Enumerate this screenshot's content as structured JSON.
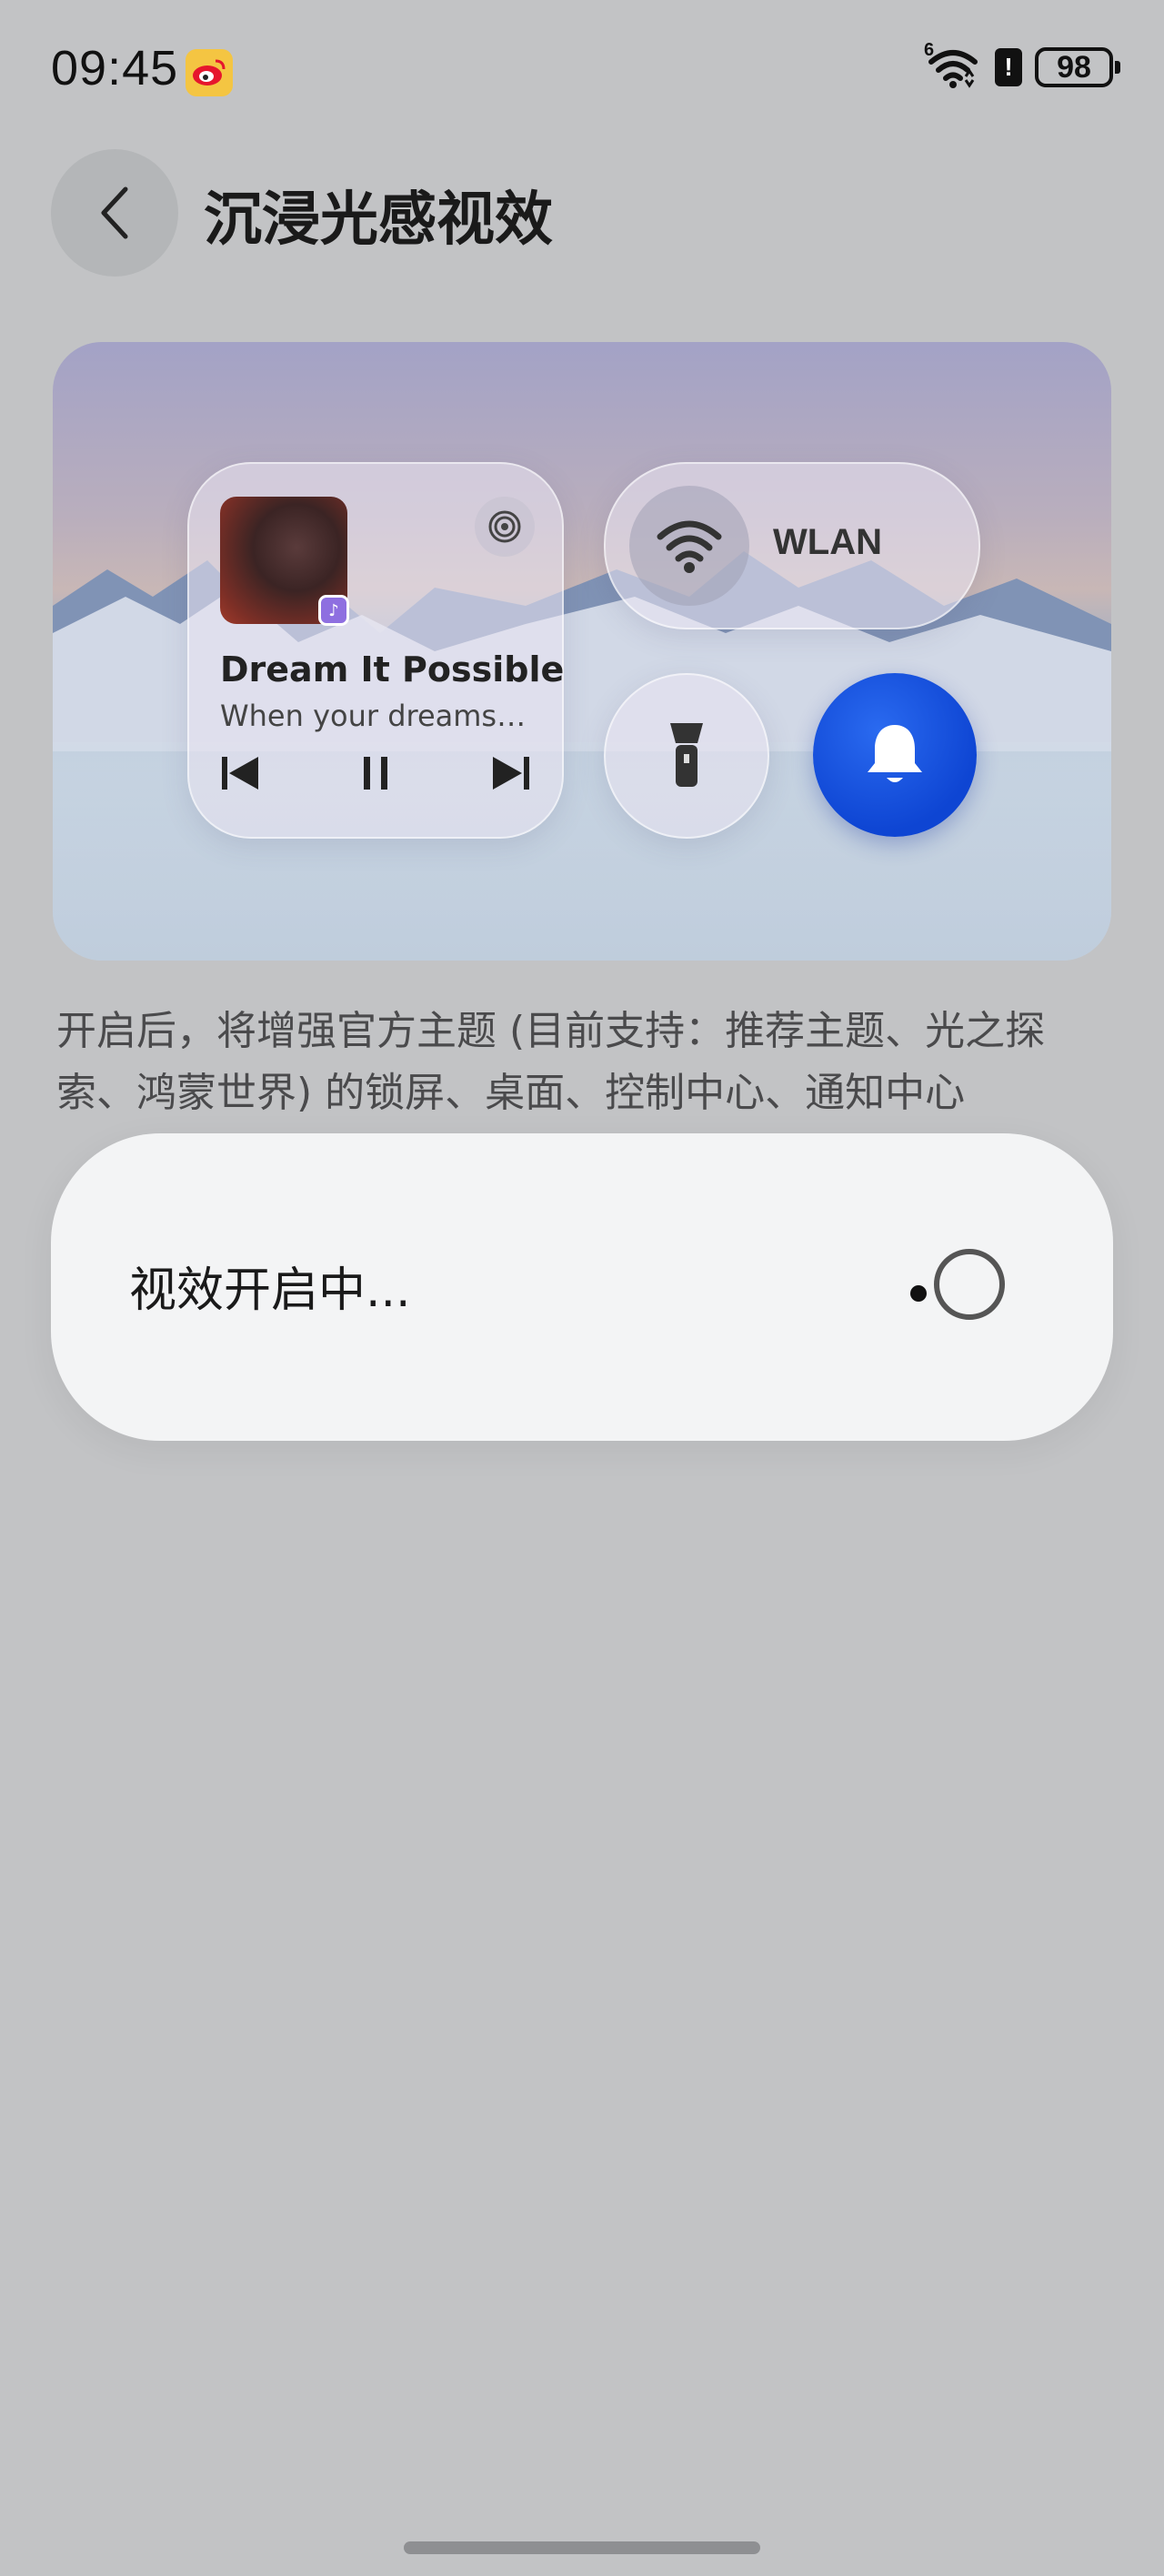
{
  "status_bar": {
    "time": "09:45",
    "network": "6",
    "battery": "98"
  },
  "header": {
    "title": "沉浸光感视效"
  },
  "preview": {
    "music": {
      "title": "Dream It Possible",
      "subtitle": "When your dreams…"
    },
    "wlan": {
      "label": "WLAN"
    },
    "accent_color": "#1347d8"
  },
  "description": "开启后，将增强官方主题 (目前支持：推荐主题、光之探索、鸿蒙世界) 的锁屏、桌面、控制中心、通知中心",
  "dialog": {
    "message": "视效开启中..."
  }
}
